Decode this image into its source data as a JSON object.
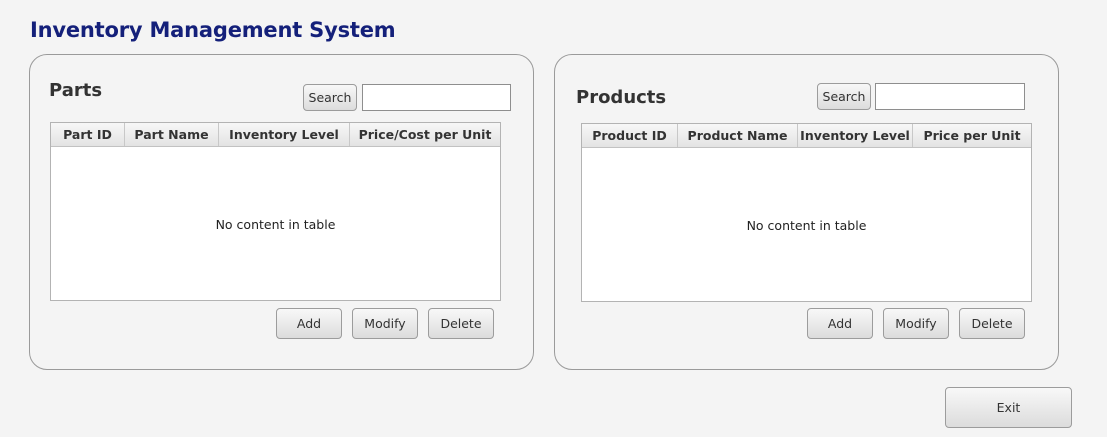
{
  "app": {
    "title": "Inventory Management System"
  },
  "parts": {
    "title": "Parts",
    "search_label": "Search",
    "search_value": "",
    "columns": [
      "Part ID",
      "Part Name",
      "Inventory Level",
      "Price/Cost per Unit"
    ],
    "empty_message": "No content in table",
    "add_label": "Add",
    "modify_label": "Modify",
    "delete_label": "Delete"
  },
  "products": {
    "title": "Products",
    "search_label": "Search",
    "search_value": "",
    "columns": [
      "Product ID",
      "Product Name",
      "Inventory Level",
      "Price per Unit"
    ],
    "empty_message": "No content in table",
    "add_label": "Add",
    "modify_label": "Modify",
    "delete_label": "Delete"
  },
  "exit_label": "Exit",
  "colors": {
    "title": "#14207a",
    "background": "#f4f4f4"
  }
}
